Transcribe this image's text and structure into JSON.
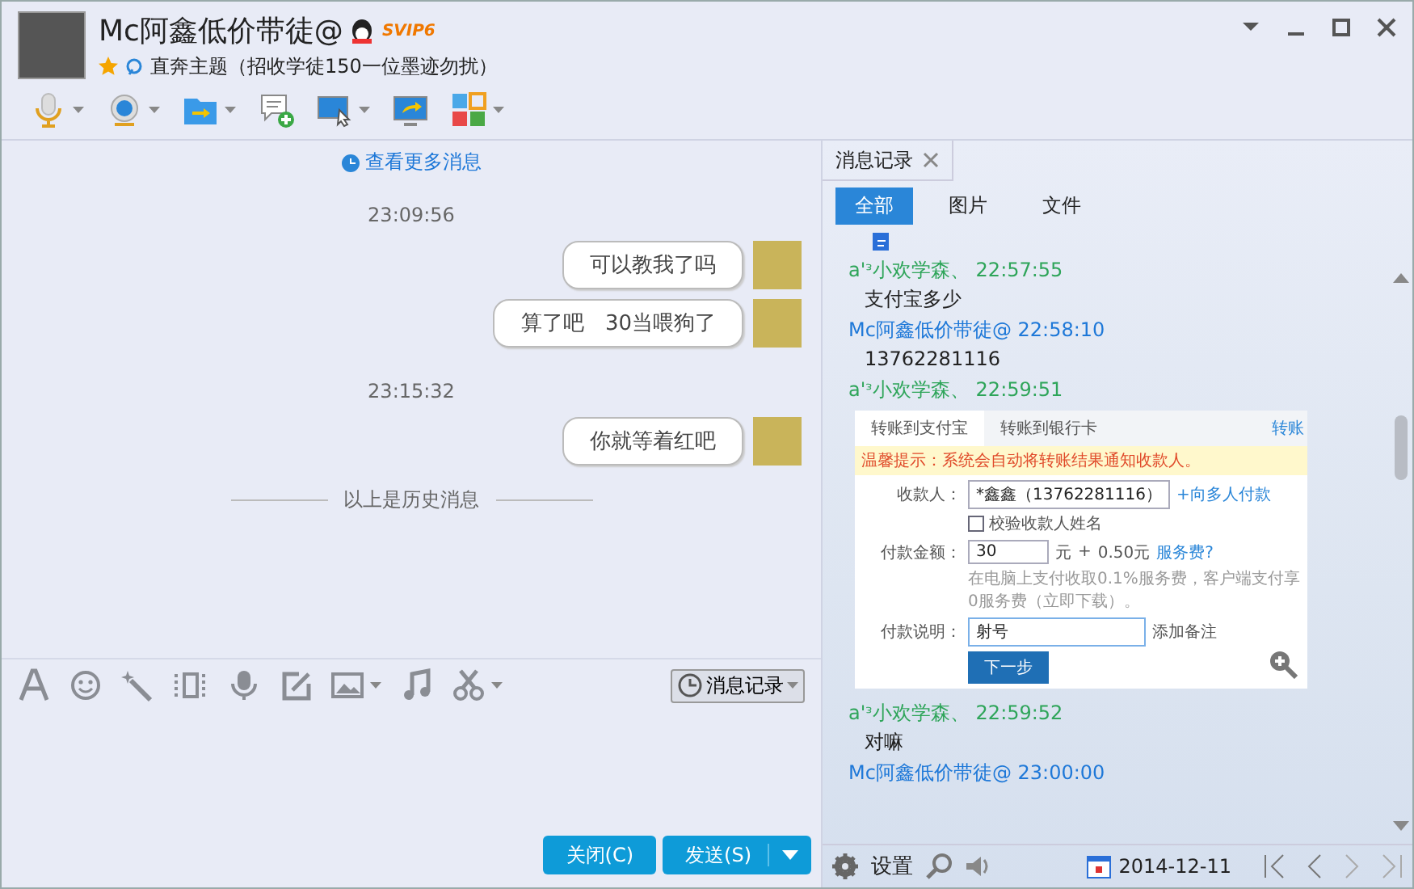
{
  "header": {
    "name": "Mc阿鑫低价带徒@",
    "vip_badge": "SVIP6",
    "status": "直奔主题（招收学徒150一位墨迹勿扰）"
  },
  "chat": {
    "more_link": "查看更多消息",
    "items": [
      {
        "kind": "time",
        "text": "23:09:56"
      },
      {
        "kind": "message",
        "text": "可以教我了吗"
      },
      {
        "kind": "message",
        "text": "算了吧　30当喂狗了"
      },
      {
        "kind": "time",
        "text": "23:15:32"
      },
      {
        "kind": "message",
        "text": "你就等着红吧"
      },
      {
        "kind": "divider",
        "text": "以上是历史消息"
      }
    ]
  },
  "input": {
    "history_button": "消息记录"
  },
  "buttons": {
    "close": "关闭(C)",
    "send": "发送(S)"
  },
  "history": {
    "tab": "消息记录",
    "filters": [
      {
        "label": "全部",
        "selected": true
      },
      {
        "label": "图片",
        "selected": false
      },
      {
        "label": "文件",
        "selected": false
      }
    ],
    "entries": [
      {
        "kind": "file"
      },
      {
        "kind": "header",
        "sender": "a'ᵌ小欢学森、",
        "time": "22:57:55",
        "color": "#2fa55a"
      },
      {
        "kind": "text",
        "text": "支付宝多少"
      },
      {
        "kind": "header",
        "sender": "Mc阿鑫低价带徒@",
        "time": "22:58:10",
        "color": "#1e78d8"
      },
      {
        "kind": "text",
        "text": "13762281116"
      },
      {
        "kind": "header",
        "sender": "a'ᵌ小欢学森、",
        "time": "22:59:51",
        "color": "#2fa55a"
      },
      {
        "kind": "screenshot"
      },
      {
        "kind": "header",
        "sender": "a'ᵌ小欢学森、",
        "time": "22:59:52",
        "color": "#2fa55a"
      },
      {
        "kind": "text",
        "text": "对嘛"
      },
      {
        "kind": "header",
        "sender": "Mc阿鑫低价带徒@",
        "time": "23:00:00",
        "color": "#1e78d8"
      }
    ],
    "transfer": {
      "tabs": [
        {
          "label": "转账到支付宝",
          "selected": true
        },
        {
          "label": "转账到银行卡",
          "selected": false
        }
      ],
      "tab_link": "转账",
      "notice": "温馨提示：系统会自动将转账结果通知收款人。",
      "recipient": {
        "label": "收款人：",
        "value": "*鑫鑫（13762281116）",
        "link": "+向多人付款",
        "verify": "校验收款人姓名",
        "checked": false
      },
      "amount": {
        "label": "付款金额：",
        "value": "30",
        "unit": "元",
        "plus": "+",
        "fee": "0.50元",
        "fee_link": "服务费?",
        "note": "在电脑上支付收取0.1%服务费，客户端支付享0服务费（立即下载）。"
      },
      "memo": {
        "label": "付款说明：",
        "value": "射号",
        "hint": "添加备注"
      },
      "submit": "下一步"
    }
  },
  "footer": {
    "settings": "设置",
    "date": "2014-12-11"
  }
}
